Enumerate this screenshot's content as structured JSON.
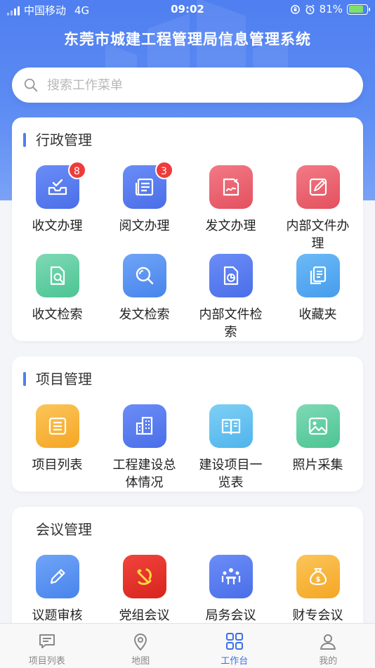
{
  "status_bar": {
    "carrier": "中国移动",
    "network": "4G",
    "time": "09:02",
    "battery": "81%",
    "battery_level": 0.81
  },
  "header": {
    "title": "东莞市城建工程管理局信息管理系统"
  },
  "search": {
    "placeholder": "搜索工作菜单",
    "value": ""
  },
  "sections": [
    {
      "title": "行政管理",
      "items": [
        {
          "label": "收文办理",
          "icon": "inbox-check-icon",
          "badge": "8"
        },
        {
          "label": "阅文办理",
          "icon": "newspaper-icon",
          "badge": "3"
        },
        {
          "label": "发文办理",
          "icon": "sign-document-icon"
        },
        {
          "label": "内部文件办理",
          "icon": "edit-document-icon"
        },
        {
          "label": "收文检索",
          "icon": "file-search-icon"
        },
        {
          "label": "发文检索",
          "icon": "magnifier-icon"
        },
        {
          "label": "内部文件检索",
          "icon": "file-chart-icon"
        },
        {
          "label": "收藏夹",
          "icon": "documents-icon"
        }
      ]
    },
    {
      "title": "项目管理",
      "items": [
        {
          "label": "项目列表",
          "icon": "list-icon"
        },
        {
          "label": "工程建设总体情况",
          "icon": "building-icon"
        },
        {
          "label": "建设项目一览表",
          "icon": "book-icon"
        },
        {
          "label": "照片采集",
          "icon": "photo-icon"
        }
      ]
    },
    {
      "title": "会议管理",
      "items": [
        {
          "label": "议题审核",
          "icon": "pencil-icon"
        },
        {
          "label": "党组会议",
          "icon": "party-emblem-icon"
        },
        {
          "label": "局务会议",
          "icon": "meeting-icon"
        },
        {
          "label": "财专会议",
          "icon": "money-bag-icon"
        }
      ]
    }
  ],
  "tabbar": [
    {
      "label": "项目列表",
      "icon": "message-list-icon",
      "active": false
    },
    {
      "label": "地图",
      "icon": "map-pin-icon",
      "active": false
    },
    {
      "label": "工作台",
      "icon": "grid-icon",
      "active": true
    },
    {
      "label": "我的",
      "icon": "user-icon",
      "active": false
    }
  ],
  "colors": {
    "primary": "#4f7ff0",
    "badge": "#ef3b3b",
    "active_tab": "#3b6fe8"
  }
}
